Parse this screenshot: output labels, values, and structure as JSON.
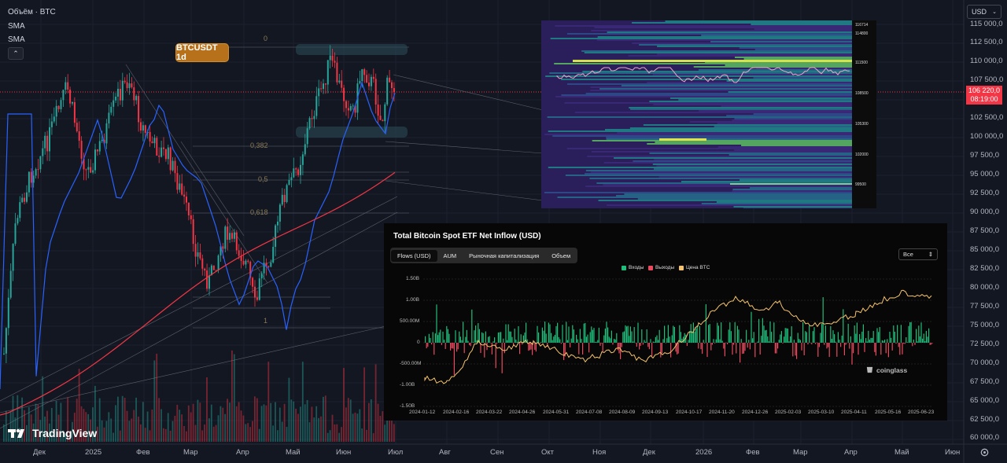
{
  "legend": {
    "symbol": "Объём · BTC",
    "sma1": "SMA",
    "sma2": "SMA",
    "collapse_icon": "chevron-up-icon"
  },
  "badge": "BTCUSDT 1d",
  "currency": {
    "value": "USD",
    "icon": "chevron-down-icon"
  },
  "price_tag": {
    "price": "106 220,0",
    "countdown": "08:19:00"
  },
  "price_axis": [
    "115 000,0",
    "112 500,0",
    "110 000,0",
    "107 500,0",
    "102 500,0",
    "100 000,0",
    "97 500,0",
    "95 000,0",
    "92 500,0",
    "90 000,0",
    "87 500,0",
    "85 000,0",
    "82 500,0",
    "80 000,0",
    "77 500,0",
    "75 000,0",
    "72 500,0",
    "70 000,0",
    "67 500,0",
    "65 000,0",
    "62 500,0",
    "60 000,0"
  ],
  "time_axis": [
    "Дек",
    "2025",
    "Фев",
    "Мар",
    "Апр",
    "Май",
    "Июн",
    "Июл",
    "Авг",
    "Сен",
    "Окт",
    "Ноя",
    "Дек",
    "2026",
    "Фев",
    "Мар",
    "Апр",
    "Май",
    "Июн"
  ],
  "fib_labels": [
    "0",
    "0,382",
    "0,5",
    "0,618",
    "1"
  ],
  "tradingview_logo": "TradingView",
  "colors": {
    "bull": "#26a69a",
    "bear": "#f23645",
    "sma_blue": "#2962ff",
    "sma_red": "#f23645",
    "badge": "#b8711b"
  },
  "etf": {
    "title": "Total Bitcoin Spot ETF Net Inflow (USD)",
    "tabs": [
      "Flows (USD)",
      "AUM",
      "Рыночная капитализация",
      "Объем"
    ],
    "active_tab": "Flows (USD)",
    "range": "Все",
    "legend": [
      "Входы",
      "Выходы",
      "Цена BTC"
    ],
    "colors": {
      "inflow": "#1fbc7b",
      "outflow": "#e84a5f",
      "price": "#f5c36b"
    },
    "watermark": "coinglass",
    "y_left": [
      "1.50B",
      "1.00B",
      "500.00M",
      "0",
      "-500.00M",
      "-1.00B",
      "-1.50B"
    ],
    "x_labels": [
      "2024-01-12",
      "2024-02-16",
      "2024-03-22",
      "2024-04-26",
      "2024-05-31",
      "2024-07-08",
      "2024-08-09",
      "2024-09-13",
      "2024-10-17",
      "2024-11-20",
      "2024-12-26",
      "2025-02-03",
      "2025-03-10",
      "2025-04-11",
      "2025-05-16",
      "2025-06-23"
    ]
  },
  "heatmap": {
    "labels": [
      "116714",
      "114800",
      "111500",
      "108500",
      "105300",
      "102000",
      "99500"
    ]
  }
}
